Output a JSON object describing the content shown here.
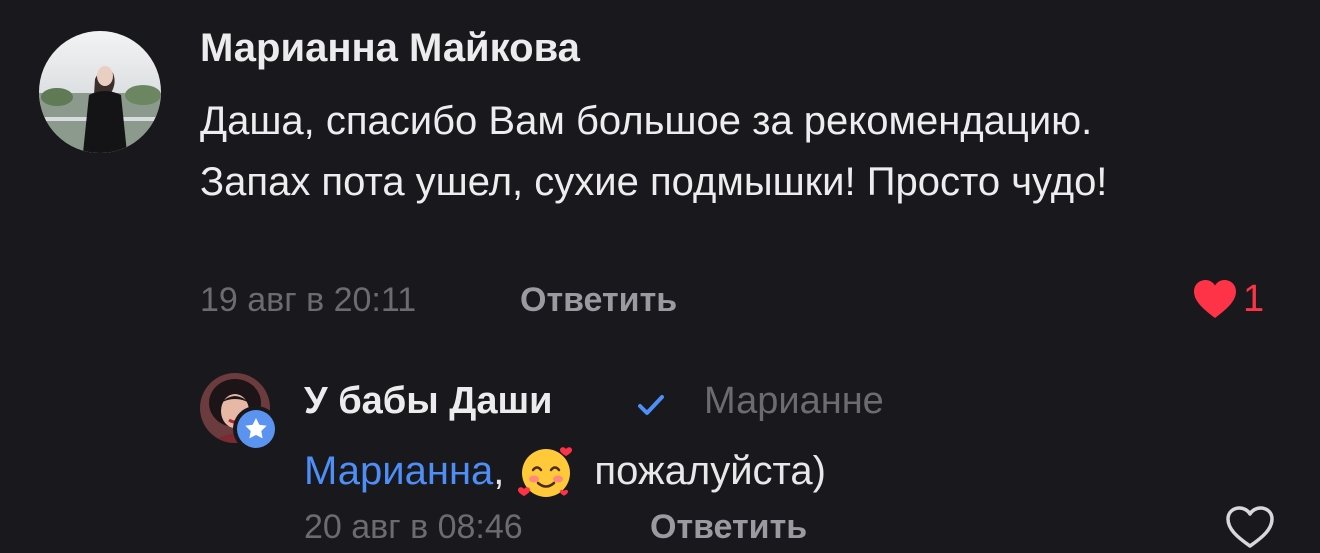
{
  "comment": {
    "author": "Марианна Майкова",
    "text": "Даша, спасибо Вам большое за рекомендацию. Запах пота ушел, сухие подмышки! Просто чудо!",
    "timestamp": "19 авг в 20:11",
    "reply_label": "Ответить",
    "likes": "1",
    "liked": true
  },
  "reply": {
    "author": "У бабы Даши",
    "verified": true,
    "addressee": "Марианне",
    "mention": "Марианна",
    "separator": ",",
    "emoji": "smiling-face-with-hearts",
    "text": "пожалуйста)",
    "timestamp": "20 авг в 08:46",
    "reply_label": "Ответить",
    "liked": false
  },
  "colors": {
    "background": "#19181c",
    "mention": "#4d8ef7",
    "like_red": "#ff3347",
    "verified_blue": "#4d8ef7",
    "muted": "#6b6b70"
  }
}
